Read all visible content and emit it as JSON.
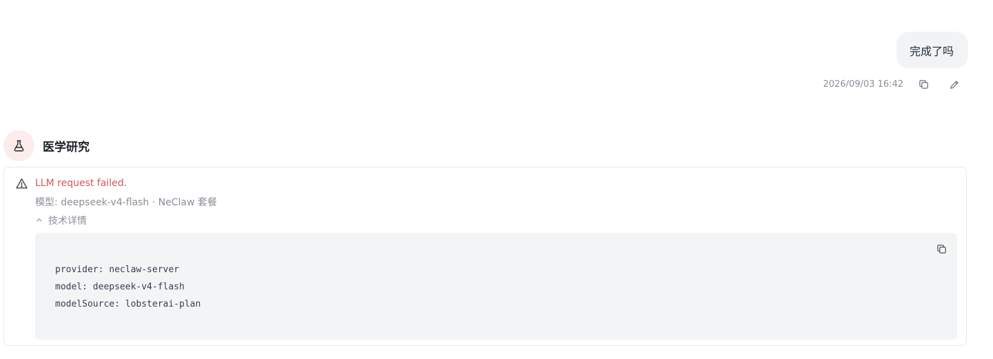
{
  "user_message": {
    "text": "完成了吗",
    "timestamp": "2026/09/03 16:42",
    "actions": [
      {
        "name": "copy",
        "icon": "copy-icon"
      },
      {
        "name": "edit",
        "icon": "pencil-icon"
      }
    ]
  },
  "assistant": {
    "name": "医学研究",
    "avatar_icon": "flask-icon",
    "avatar_bg": "#fdecec"
  },
  "error": {
    "icon": "warning-icon",
    "title": "LLM request failed.",
    "title_color": "#e05252",
    "model_line": "模型: deepseek-v4-flash · NeClaw 套餐",
    "details_toggle": "技术详情",
    "details_expanded": true,
    "code_lines": [
      "provider: neclaw-server",
      "model: deepseek-v4-flash",
      "modelSource: lobsterai-plan"
    ]
  }
}
